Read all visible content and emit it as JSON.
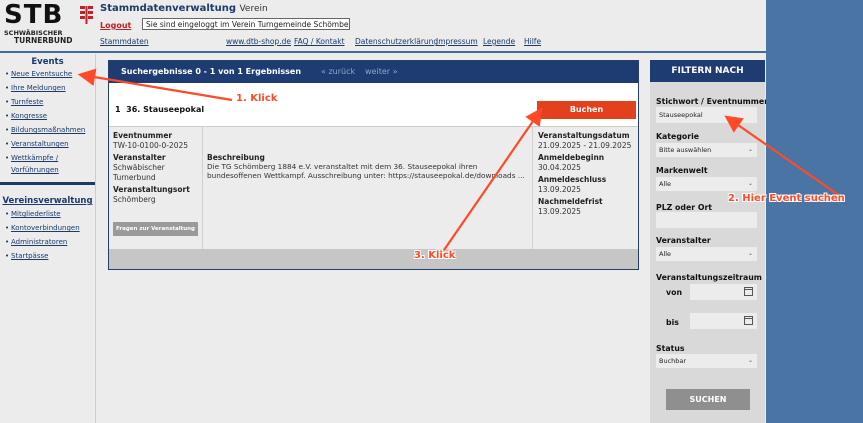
{
  "header": {
    "logo_main": "STB",
    "logo_sub1": "SCHWÄBISCHER",
    "logo_sub2": "TURNERBUND",
    "app_title": "Stammdatenverwaltung",
    "app_subtitle": "Verein",
    "logout_label": "Logout",
    "login_status": "Sie sind eingeloggt im Verein Turngemeinde Schömberg e.V.",
    "nav": [
      {
        "label": "Stammdaten"
      },
      {
        "label": "www.dtb-shop.de"
      },
      {
        "label": "FAQ / Kontakt"
      },
      {
        "label": "Datenschutzerklärung"
      },
      {
        "label": "Impressum"
      },
      {
        "label": "Legende"
      },
      {
        "label": "Hilfe"
      }
    ]
  },
  "sidebar": {
    "events_title": "Events",
    "events_items": [
      {
        "label": "Neue Eventsuche"
      },
      {
        "label": "Ihre Meldungen"
      },
      {
        "label": "Turnfeste"
      },
      {
        "label": "Kongresse"
      },
      {
        "label": "Bildungsmaßnahmen"
      },
      {
        "label": "Veranstaltungen"
      },
      {
        "label": "Wettkämpfe /"
      },
      {
        "label": "Vorführungen"
      }
    ],
    "verein_title": "Vereinsverwaltung",
    "verein_items": [
      {
        "label": "Mitgliederliste"
      },
      {
        "label": "Kontoverbindungen"
      },
      {
        "label": "Administratoren"
      },
      {
        "label": "Startpässe"
      }
    ]
  },
  "results": {
    "summary": "Suchergebnisse 0 - 1 von 1 Ergebnissen",
    "prev_label": "« zurück",
    "next_label": "weiter »",
    "item": {
      "index": "1",
      "title": "36. Stauseepokal",
      "book_label": "Buchen",
      "eventnummer_label": "Eventnummer",
      "eventnummer": "TW-10-0100-0-2025",
      "veranstalter_label": "Veranstalter",
      "veranstalter_line1": "Schwäbischer",
      "veranstalter_line2": "Turnerbund",
      "ort_label": "Veranstaltungsort",
      "ort": "Schömberg",
      "fragen_label": "Fragen zur Veranstaltung",
      "beschreibung_label": "Beschreibung",
      "beschreibung": "Die TG Schömberg 1884 e.V. veranstaltet mit dem 36. Stauseepokal ihren bundesoffenen Wettkampf. Ausschreibung unter: https://stauseepokal.de/downloads ...",
      "datum_label": "Veranstaltungsdatum",
      "datum": "21.09.2025 - 21.09.2025",
      "anmeldebeginn_label": "Anmeldebeginn",
      "anmeldebeginn": "30.04.2025",
      "anmeldeschluss_label": "Anmeldeschluss",
      "anmeldeschluss": "13.09.2025",
      "nachmeldefrist_label": "Nachmeldefrist",
      "nachmeldefrist": "13.09.2025"
    }
  },
  "filter": {
    "title": "FILTERN NACH",
    "stichwort_label": "Stichwort / Eventnummer",
    "stichwort_value": "Stauseepokal",
    "kategorie_label": "Kategorie",
    "kategorie_value": "Bitte auswählen",
    "markenwelt_label": "Markenwelt",
    "markenwelt_value": "Alle",
    "plz_label": "PLZ oder Ort",
    "plz_value": "",
    "veranstalter_label": "Veranstalter",
    "veranstalter_value": "Alle",
    "zeitraum_label": "Veranstaltungszeitraum",
    "von_label": "von",
    "bis_label": "bis",
    "status_label": "Status",
    "status_value": "Buchbar",
    "submit_label": "SUCHEN"
  },
  "annotations": {
    "step1": "1. Klick",
    "step2": "2. Hier Event suchen",
    "step3": "3. Klick"
  },
  "colors": {
    "navy": "#1e3c72",
    "accent_red": "#e3401e",
    "annotation": "#ff4a2a",
    "side_band": "#4a74a3"
  }
}
